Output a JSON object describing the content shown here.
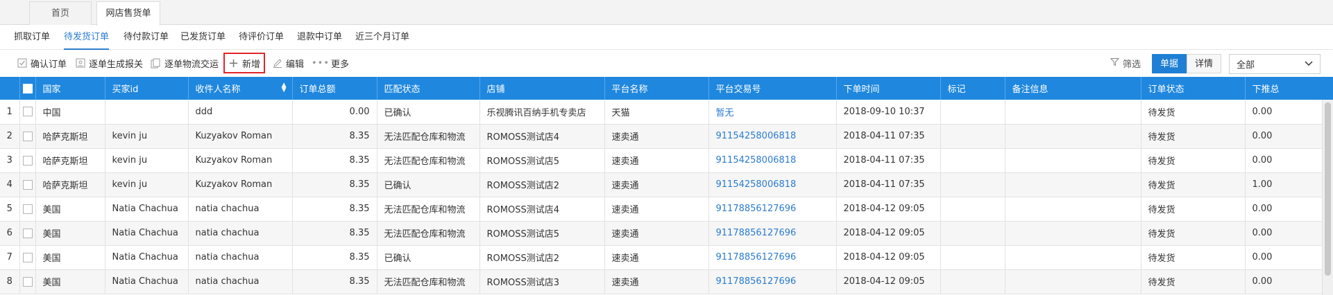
{
  "top_tabs": [
    {
      "label": "首页"
    },
    {
      "label": "网店售货单"
    }
  ],
  "sub_tabs": [
    {
      "label": "抓取订单"
    },
    {
      "label": "待发货订单"
    },
    {
      "label": "待付款订单"
    },
    {
      "label": "已发货订单"
    },
    {
      "label": "待评价订单"
    },
    {
      "label": "退款中订单"
    },
    {
      "label": "近三个月订单"
    }
  ],
  "toolbar": {
    "confirm": "确认订单",
    "customs": "逐单生成报关",
    "logistics": "逐单物流交运",
    "add": "新增",
    "edit": "编辑",
    "more": "更多",
    "filter": "筛选",
    "view_single": "单据",
    "view_detail": "详情",
    "select_value": "全部"
  },
  "table": {
    "headers": [
      "国家",
      "买家id",
      "收件人名称",
      "订单总额",
      "匹配状态",
      "店铺",
      "平台名称",
      "平台交易号",
      "下单时间",
      "标记",
      "备注信息",
      "订单状态",
      "下推总"
    ],
    "rows": [
      {
        "idx": "1",
        "country": "中国",
        "buyer": "",
        "recipient": "ddd",
        "total": "0.00",
        "match": "已确认",
        "shop": "乐视腾讯百纳手机专卖店",
        "platform": "天猫",
        "trade_no": "暂无",
        "time": "2018-09-10 10:37",
        "mark": "",
        "note": "",
        "status": "待发货",
        "pushed": "0.00"
      },
      {
        "idx": "2",
        "country": "哈萨克斯坦",
        "buyer": "kevin ju",
        "recipient": "Kuzyakov Roman",
        "total": "8.35",
        "match": "无法匹配仓库和物流",
        "shop": "ROMOSS测试店4",
        "platform": "速卖通",
        "trade_no": "91154258006818",
        "time": "2018-04-11 07:35",
        "mark": "",
        "note": "",
        "status": "待发货",
        "pushed": "0.00"
      },
      {
        "idx": "3",
        "country": "哈萨克斯坦",
        "buyer": "kevin ju",
        "recipient": "Kuzyakov Roman",
        "total": "8.35",
        "match": "无法匹配仓库和物流",
        "shop": "ROMOSS测试店5",
        "platform": "速卖通",
        "trade_no": "91154258006818",
        "time": "2018-04-11 07:35",
        "mark": "",
        "note": "",
        "status": "待发货",
        "pushed": "0.00"
      },
      {
        "idx": "4",
        "country": "哈萨克斯坦",
        "buyer": "kevin ju",
        "recipient": "Kuzyakov Roman",
        "total": "8.35",
        "match": "已确认",
        "shop": "ROMOSS测试店2",
        "platform": "速卖通",
        "trade_no": "91154258006818",
        "time": "2018-04-11 07:35",
        "mark": "",
        "note": "",
        "status": "待发货",
        "pushed": "1.00"
      },
      {
        "idx": "5",
        "country": "美国",
        "buyer": "Natia Chachua",
        "recipient": "natia chachua",
        "total": "8.35",
        "match": "无法匹配仓库和物流",
        "shop": "ROMOSS测试店4",
        "platform": "速卖通",
        "trade_no": "91178856127696",
        "time": "2018-04-12 09:05",
        "mark": "",
        "note": "",
        "status": "待发货",
        "pushed": "0.00"
      },
      {
        "idx": "6",
        "country": "美国",
        "buyer": "Natia Chachua",
        "recipient": "natia chachua",
        "total": "8.35",
        "match": "无法匹配仓库和物流",
        "shop": "ROMOSS测试店5",
        "platform": "速卖通",
        "trade_no": "91178856127696",
        "time": "2018-04-12 09:05",
        "mark": "",
        "note": "",
        "status": "待发货",
        "pushed": "0.00"
      },
      {
        "idx": "7",
        "country": "美国",
        "buyer": "Natia Chachua",
        "recipient": "natia chachua",
        "total": "8.35",
        "match": "已确认",
        "shop": "ROMOSS测试店2",
        "platform": "速卖通",
        "trade_no": "91178856127696",
        "time": "2018-04-12 09:05",
        "mark": "",
        "note": "",
        "status": "待发货",
        "pushed": "0.00"
      },
      {
        "idx": "8",
        "country": "美国",
        "buyer": "Natia Chachua",
        "recipient": "natia chachua",
        "total": "8.35",
        "match": "无法匹配仓库和物流",
        "shop": "ROMOSS测试店3",
        "platform": "速卖通",
        "trade_no": "91178856127696",
        "time": "2018-04-12 09:05",
        "mark": "",
        "note": "",
        "status": "待发货",
        "pushed": "0.00"
      }
    ]
  },
  "colors": {
    "accent": "#1f87de",
    "link": "#2b7ccf",
    "highlight_border": "#e0242a"
  }
}
